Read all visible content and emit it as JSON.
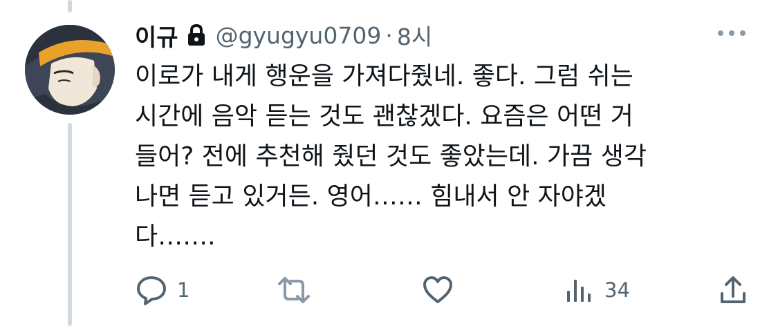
{
  "post": {
    "display_name": "이규",
    "handle": "@gyugyu0709",
    "separator": "·",
    "time": "8시",
    "protected_icon": "lock-icon",
    "text_lines": [
      "이로가 내게 행운을 가져다줬네. 좋다. 그럼 쉬는",
      "시간에 음악 듣는 것도 괜찮겠다. 요즘은 어떤 거",
      "들어? 전에 추천해 줬던 것도 좋았는데. 가끔 생각",
      "나면 듣고 있거든. 영어…… 힘내서 안 자야겠",
      "다…….",
      ""
    ]
  },
  "actions": {
    "reply": {
      "icon": "reply-icon",
      "count": "1"
    },
    "retweet": {
      "icon": "retweet-icon",
      "count": ""
    },
    "like": {
      "icon": "heart-icon",
      "count": ""
    },
    "views": {
      "icon": "analytics-icon",
      "count": "34"
    },
    "share": {
      "icon": "share-icon"
    }
  },
  "colors": {
    "text": "#0f1419",
    "secondary": "#536471",
    "thread_line": "#cfd9de",
    "background": "#ffffff"
  }
}
